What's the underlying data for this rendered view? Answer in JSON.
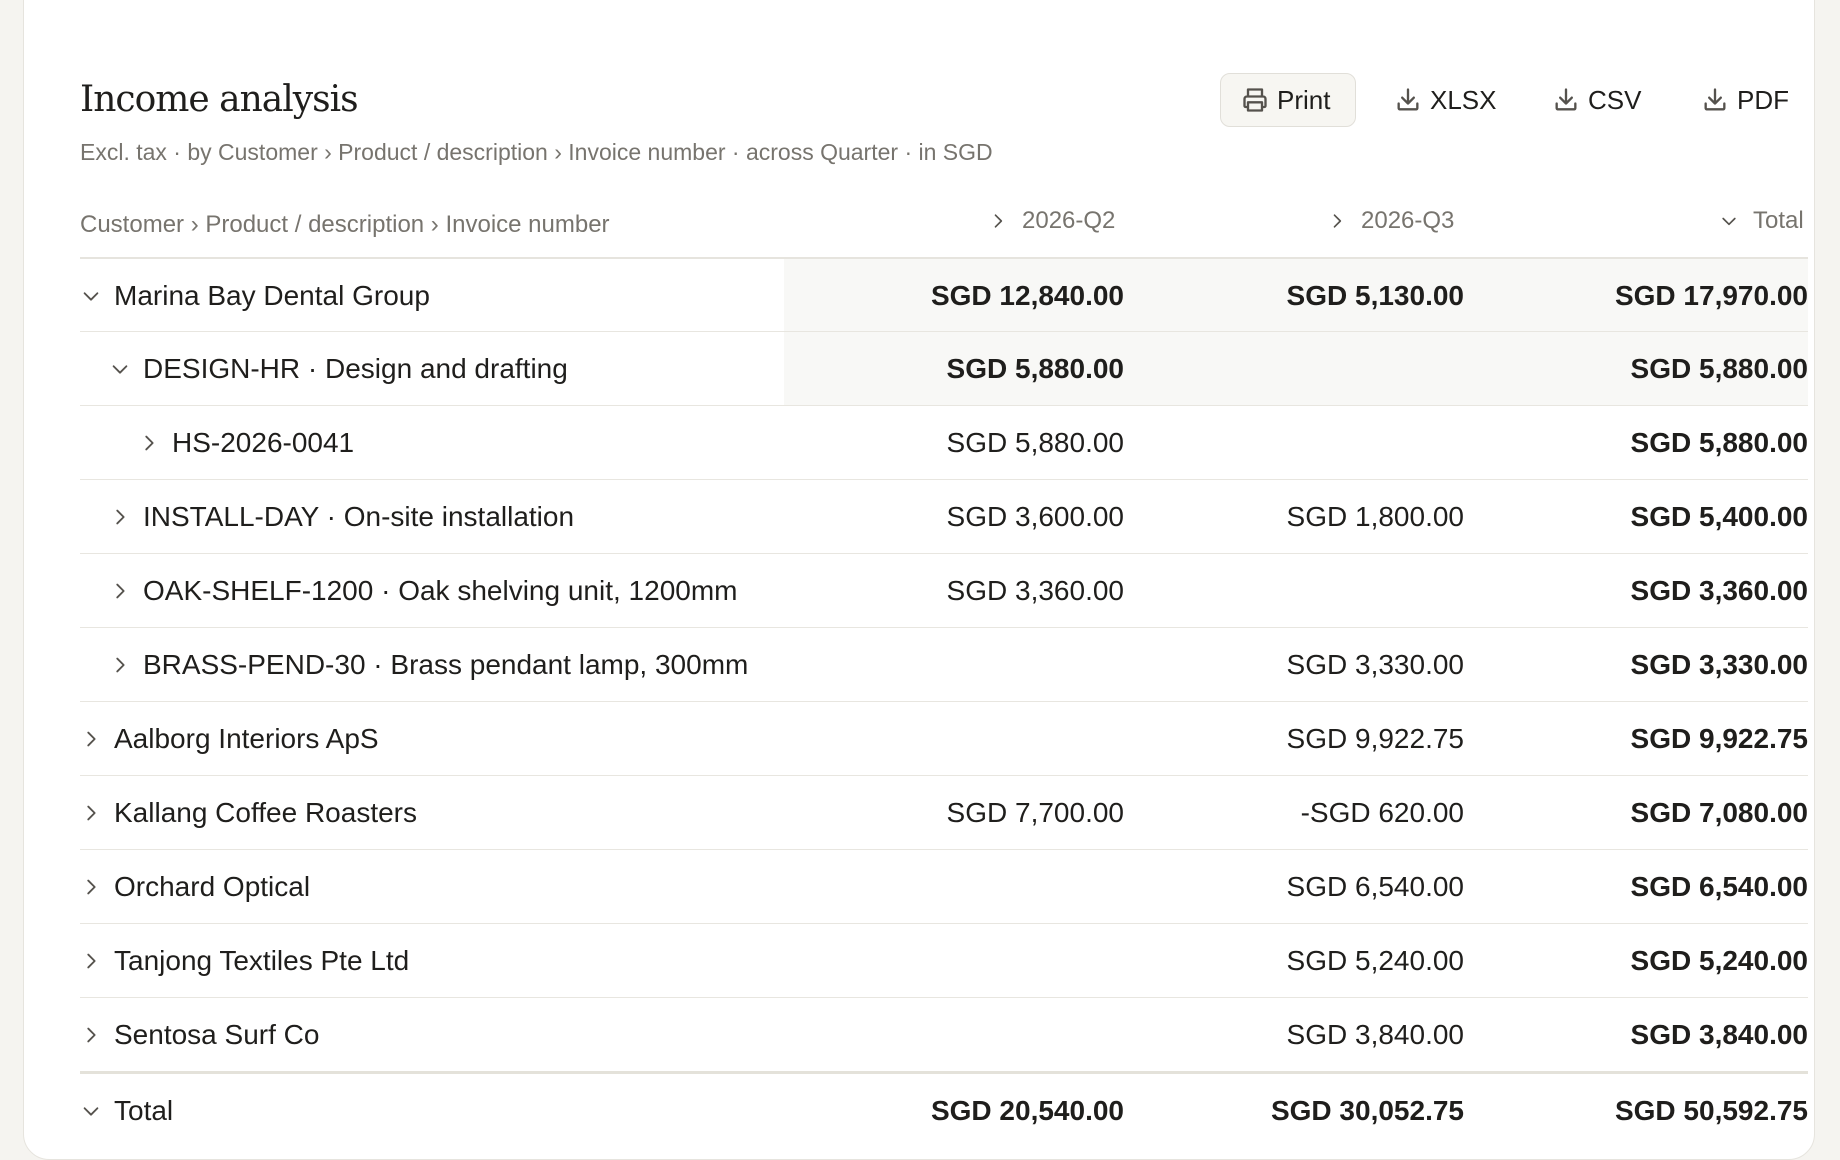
{
  "report": {
    "title": "Income analysis",
    "subtitle": "Excl. tax · by Customer › Product / description › Invoice number · across Quarter · in SGD"
  },
  "toolbar": {
    "print": "Print",
    "xlsx": "XLSX",
    "csv": "CSV",
    "pdf": "PDF"
  },
  "columns": {
    "group": "Customer › Product / description › Invoice number",
    "q2": "2026-Q2",
    "q3": "2026-Q3",
    "total": "Total"
  },
  "rows": [
    {
      "label": "Marina Bay Dental Group",
      "q2": "SGD 12,840.00",
      "q3": "SGD 5,130.00",
      "total": "SGD 17,970.00",
      "expanded": true,
      "level": 0
    },
    {
      "label": "DESIGN-HR · Design and drafting",
      "q2": "SGD 5,880.00",
      "q3": "",
      "total": "SGD 5,880.00",
      "expanded": true,
      "level": 1
    },
    {
      "label": "HS-2026-0041",
      "q2": "SGD 5,880.00",
      "q3": "",
      "total": "SGD 5,880.00",
      "expanded": false,
      "level": 2
    },
    {
      "label": "INSTALL-DAY · On-site installation",
      "q2": "SGD 3,600.00",
      "q3": "SGD 1,800.00",
      "total": "SGD 5,400.00",
      "expanded": false,
      "level": 1
    },
    {
      "label": "OAK-SHELF-1200 · Oak shelving unit, 1200mm",
      "q2": "SGD 3,360.00",
      "q3": "",
      "total": "SGD 3,360.00",
      "expanded": false,
      "level": 1
    },
    {
      "label": "BRASS-PEND-30 · Brass pendant lamp, 300mm",
      "q2": "",
      "q3": "SGD 3,330.00",
      "total": "SGD 3,330.00",
      "expanded": false,
      "level": 1
    },
    {
      "label": "Aalborg Interiors ApS",
      "q2": "",
      "q3": "SGD 9,922.75",
      "total": "SGD 9,922.75",
      "expanded": false,
      "level": 0
    },
    {
      "label": "Kallang Coffee Roasters",
      "q2": "SGD 7,700.00",
      "q3": "-SGD 620.00",
      "total": "SGD 7,080.00",
      "expanded": false,
      "level": 0
    },
    {
      "label": "Orchard Optical",
      "q2": "",
      "q3": "SGD 6,540.00",
      "total": "SGD 6,540.00",
      "expanded": false,
      "level": 0
    },
    {
      "label": "Tanjong Textiles Pte Ltd",
      "q2": "",
      "q3": "SGD 5,240.00",
      "total": "SGD 5,240.00",
      "expanded": false,
      "level": 0
    },
    {
      "label": "Sentosa Surf Co",
      "q2": "",
      "q3": "SGD 3,840.00",
      "total": "SGD 3,840.00",
      "expanded": false,
      "level": 0
    }
  ],
  "grand_total": {
    "label": "Total",
    "q2": "SGD 20,540.00",
    "q3": "SGD 30,052.75",
    "total": "SGD 50,592.75"
  },
  "icons": {
    "print": "printer-icon",
    "export": "download-icon",
    "expand": "chevron-right-icon",
    "collapse": "chevron-down-icon"
  }
}
